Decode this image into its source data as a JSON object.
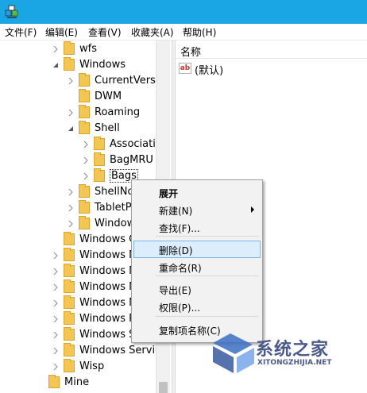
{
  "menubar": {
    "items": [
      "文件(F)",
      "编辑(E)",
      "查看(V)",
      "收藏夹(A)",
      "帮助(H)"
    ]
  },
  "tree": {
    "items": [
      {
        "label": "wfs",
        "expander": "collapsed"
      },
      {
        "label": "Windows",
        "expander": "expanded"
      },
      {
        "label": "CurrentVersic",
        "expander": "collapsed"
      },
      {
        "label": "DWM",
        "expander": "none"
      },
      {
        "label": "Roaming",
        "expander": "collapsed"
      },
      {
        "label": "Shell",
        "expander": "expanded"
      },
      {
        "label": "Associatic",
        "expander": "collapsed"
      },
      {
        "label": "BagMRU",
        "expander": "collapsed"
      },
      {
        "label": "Bags",
        "expander": "collapsed",
        "selected": true
      },
      {
        "label": "ShellNo",
        "expander": "collapsed"
      },
      {
        "label": "TabletP",
        "expander": "collapsed"
      },
      {
        "label": "Window",
        "expander": "collapsed"
      },
      {
        "label": "Windows C",
        "expander": "none"
      },
      {
        "label": "Windows M",
        "expander": "collapsed"
      },
      {
        "label": "Windows M",
        "expander": "collapsed"
      },
      {
        "label": "Windows M",
        "expander": "collapsed"
      },
      {
        "label": "Windows N",
        "expander": "collapsed"
      },
      {
        "label": "Windows P",
        "expander": "collapsed"
      },
      {
        "label": "Windows S",
        "expander": "collapsed"
      },
      {
        "label": "Windows Service",
        "expander": "collapsed"
      },
      {
        "label": "Wisp",
        "expander": "collapsed"
      },
      {
        "label": "Mine",
        "expander": "none"
      }
    ]
  },
  "list": {
    "column_name": "名称",
    "rows": [
      {
        "value": "(默认)",
        "type_icon": "ab-string-icon",
        "icon_text": "ab"
      }
    ]
  },
  "context_menu": {
    "items": [
      {
        "label": "展开",
        "bold": true
      },
      {
        "label": "新建(N)",
        "submenu": true
      },
      {
        "label": "查找(F)..."
      },
      {
        "label": "删除(D)",
        "highlighted": true
      },
      {
        "label": "重命名(R)"
      },
      {
        "label": "导出(E)"
      },
      {
        "label": "权限(P)..."
      },
      {
        "label": "复制项名称(C)"
      }
    ]
  },
  "watermark": {
    "title": "系统之家",
    "url": "XITONGZHIJIA.NET"
  },
  "colors": {
    "titlebar": "#1aa6e4",
    "folder": "#f3c555",
    "highlight": "#dceefc"
  }
}
